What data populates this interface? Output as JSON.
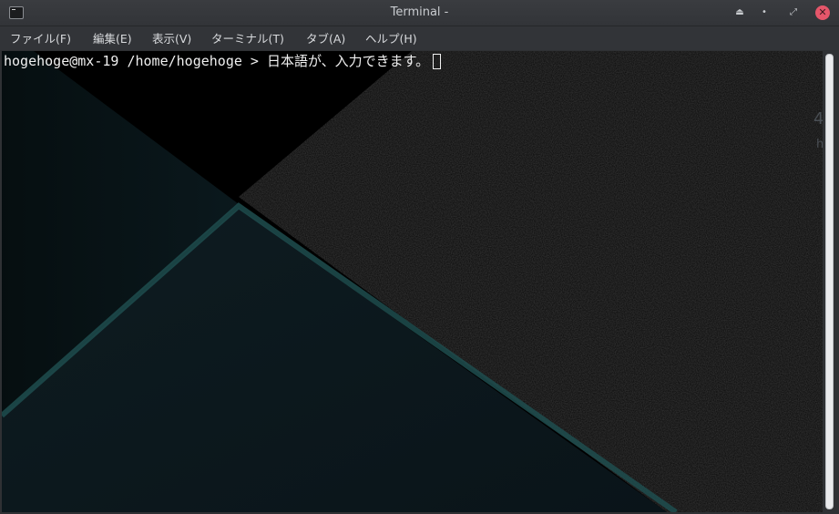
{
  "window": {
    "title": "Terminal -",
    "buttons": {
      "shade": "⏏",
      "minimize": "•",
      "maximize": "⤢",
      "close": "✕"
    }
  },
  "menubar": {
    "items": [
      "ファイル(F)",
      "編集(E)",
      "表示(V)",
      "ターミナル(T)",
      "タブ(A)",
      "ヘルプ(H)"
    ]
  },
  "terminal": {
    "prompt": "hogehoge@mx-19 /home/hogehoge > ",
    "input": "日本語が、入力できます。"
  },
  "desktop_background": {
    "partial_text_1": "4",
    "partial_text_2": "h"
  },
  "colors": {
    "terminal_bg": "#000000",
    "terminal_fg": "#f0f0f0",
    "accent_teal": "#1f4e4f",
    "close_button": "#e5566a",
    "chrome": "#323438"
  },
  "icons": {
    "app": "terminal-icon",
    "shade": "shade-icon",
    "minimize": "minimize-icon",
    "maximize": "maximize-icon",
    "close": "close-icon"
  }
}
